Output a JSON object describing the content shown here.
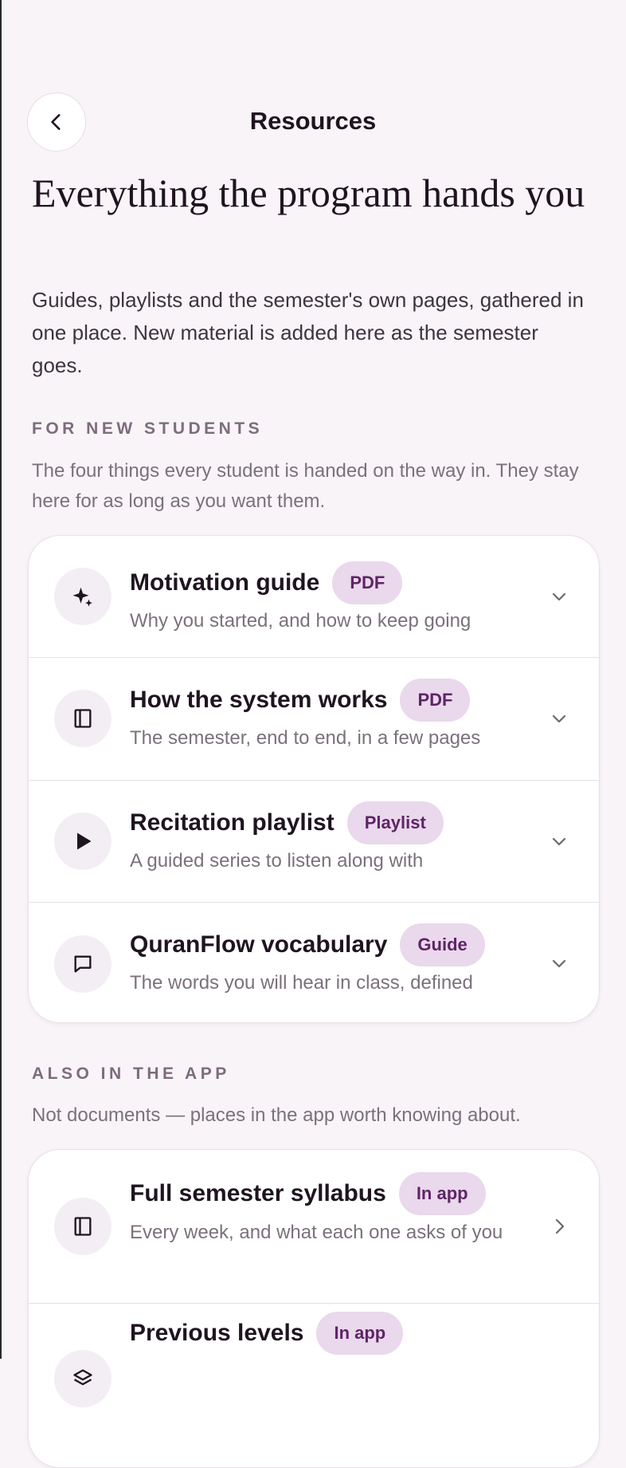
{
  "header": {
    "title": "Resources",
    "back_icon": "chevron-left-icon"
  },
  "hero": {
    "title": "Everything the program hands you",
    "description": "Guides, playlists and the semester's own pages, gathered in one place. New material is added here as the semester goes."
  },
  "new_students": {
    "label": "FOR NEW STUDENTS",
    "description": "The four things every student is handed on the way in. They stay here for as long as you want them.",
    "items": [
      {
        "title": "Motivation guide",
        "badge": "PDF",
        "subtitle": "Why you started, and how to keep going",
        "icon": "sparkle-icon"
      },
      {
        "title": "How the system works",
        "badge": "PDF",
        "subtitle": "The semester, end to end, in a few pages",
        "icon": "book-icon"
      },
      {
        "title": "Recitation playlist",
        "badge": "Playlist",
        "subtitle": "A guided series to listen along with",
        "icon": "play-icon"
      },
      {
        "title": "QuranFlow vocabulary",
        "badge": "Guide",
        "subtitle": "The words you will hear in class, defined",
        "icon": "speech-bubble-icon"
      }
    ]
  },
  "in_app": {
    "label": "ALSO IN THE APP",
    "description": "Not documents — places in the app worth knowing about.",
    "items": [
      {
        "title": "Full semester syllabus",
        "badge": "In app",
        "subtitle": "Every week, and what each one asks of you",
        "icon": "book-icon"
      },
      {
        "title": "Previous levels",
        "badge": "In app",
        "subtitle": "",
        "icon": "layers-icon"
      }
    ]
  },
  "colors": {
    "background": "#f8f4f8",
    "badge_bg": "#ead8ec",
    "badge_text": "#5e2566",
    "accent": "#5e2566"
  }
}
